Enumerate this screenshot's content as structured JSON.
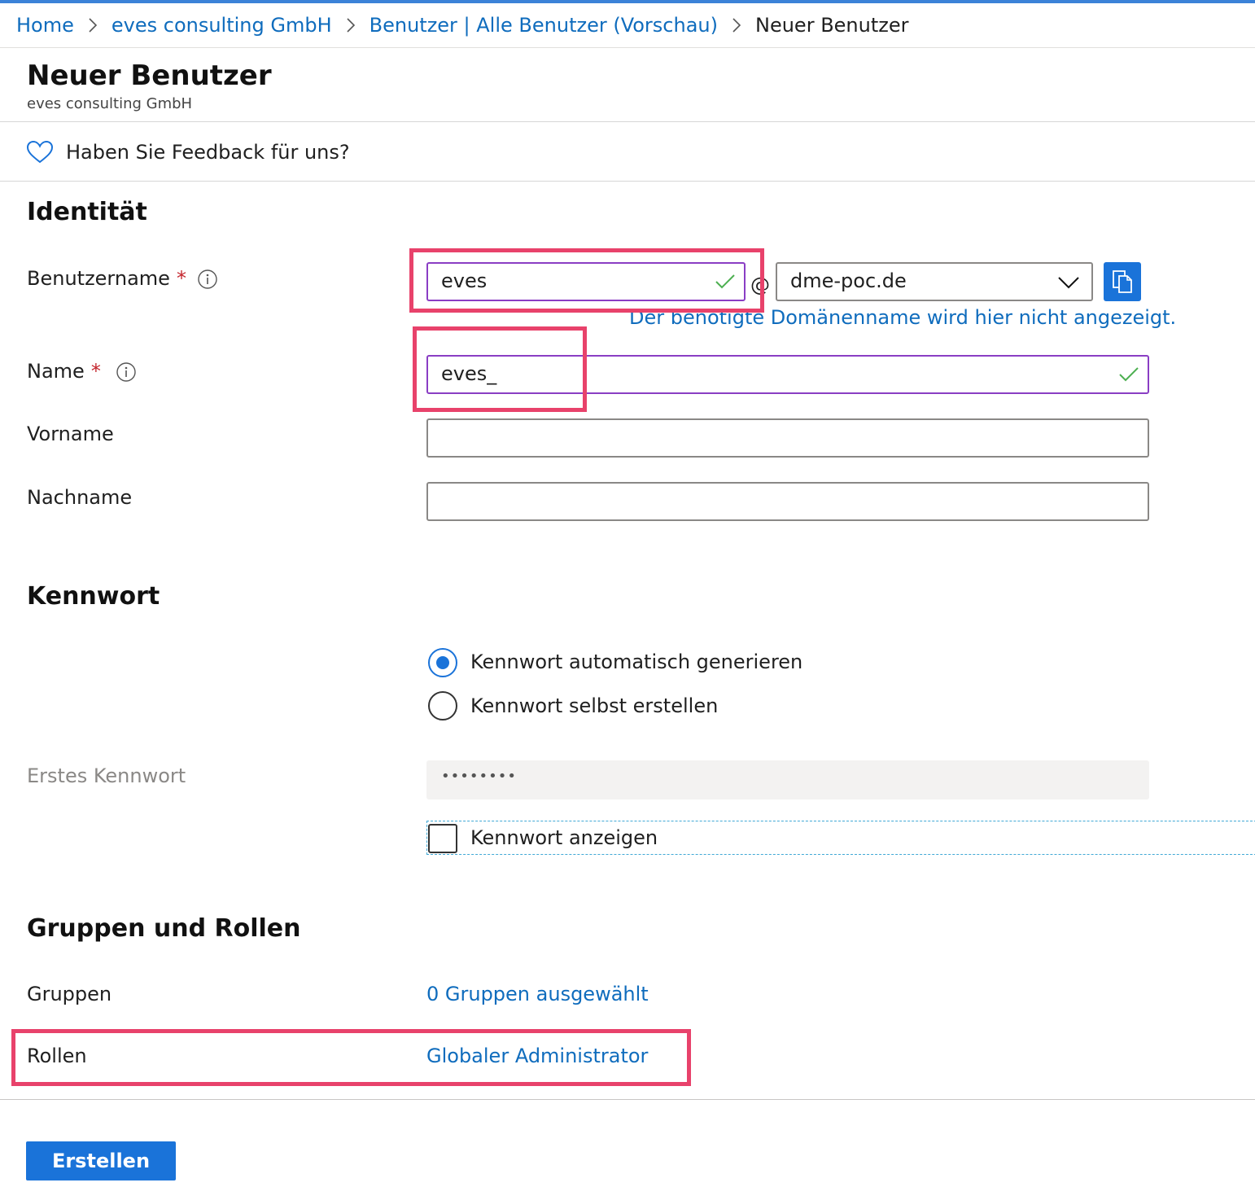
{
  "breadcrumb": {
    "items": [
      "Home",
      "eves consulting GmbH",
      "Benutzer | Alle Benutzer (Vorschau)"
    ],
    "current": "Neuer Benutzer"
  },
  "header": {
    "title": "Neuer Benutzer",
    "subtitle": "eves consulting GmbH"
  },
  "feedback": {
    "text": "Haben Sie Feedback für uns?"
  },
  "identity": {
    "section_title": "Identität",
    "username": {
      "label": "Benutzername",
      "required_mark": "*",
      "value": "eves",
      "at": "@",
      "domain": "dme-poc.de"
    },
    "domain_hint": "Der benötigte Domänenname wird hier nicht angezeigt.",
    "name": {
      "label": "Name",
      "required_mark": "*",
      "value": "eves_"
    },
    "first_name": {
      "label": "Vorname",
      "value": ""
    },
    "last_name": {
      "label": "Nachname",
      "value": ""
    }
  },
  "password": {
    "section_title": "Kennwort",
    "options": [
      "Kennwort automatisch generieren",
      "Kennwort selbst erstellen"
    ],
    "selected_option": "Kennwort automatisch generieren",
    "initial_label": "Erstes Kennwort",
    "initial_value": "••••••••",
    "show_label": "Kennwort anzeigen",
    "show_checked": false
  },
  "groups_roles": {
    "section_title": "Gruppen und Rollen",
    "groups_label": "Gruppen",
    "groups_value": "0 Gruppen ausgewählt",
    "roles_label": "Rollen",
    "roles_value": "Globaler Administrator"
  },
  "actions": {
    "create_label": "Erstellen"
  },
  "colors": {
    "accent": "#1a73d9",
    "link": "#0f6cbd",
    "highlight": "#e8426b",
    "active_border": "#8a3ec4",
    "valid_check": "#4caf50",
    "required": "#c4262e"
  },
  "icons": {
    "breadcrumb_separator": "chevron-right-icon",
    "feedback": "heart-icon",
    "info": "info-icon",
    "valid": "checkmark-icon",
    "dropdown": "chevron-down-icon",
    "copy": "copy-icon"
  }
}
